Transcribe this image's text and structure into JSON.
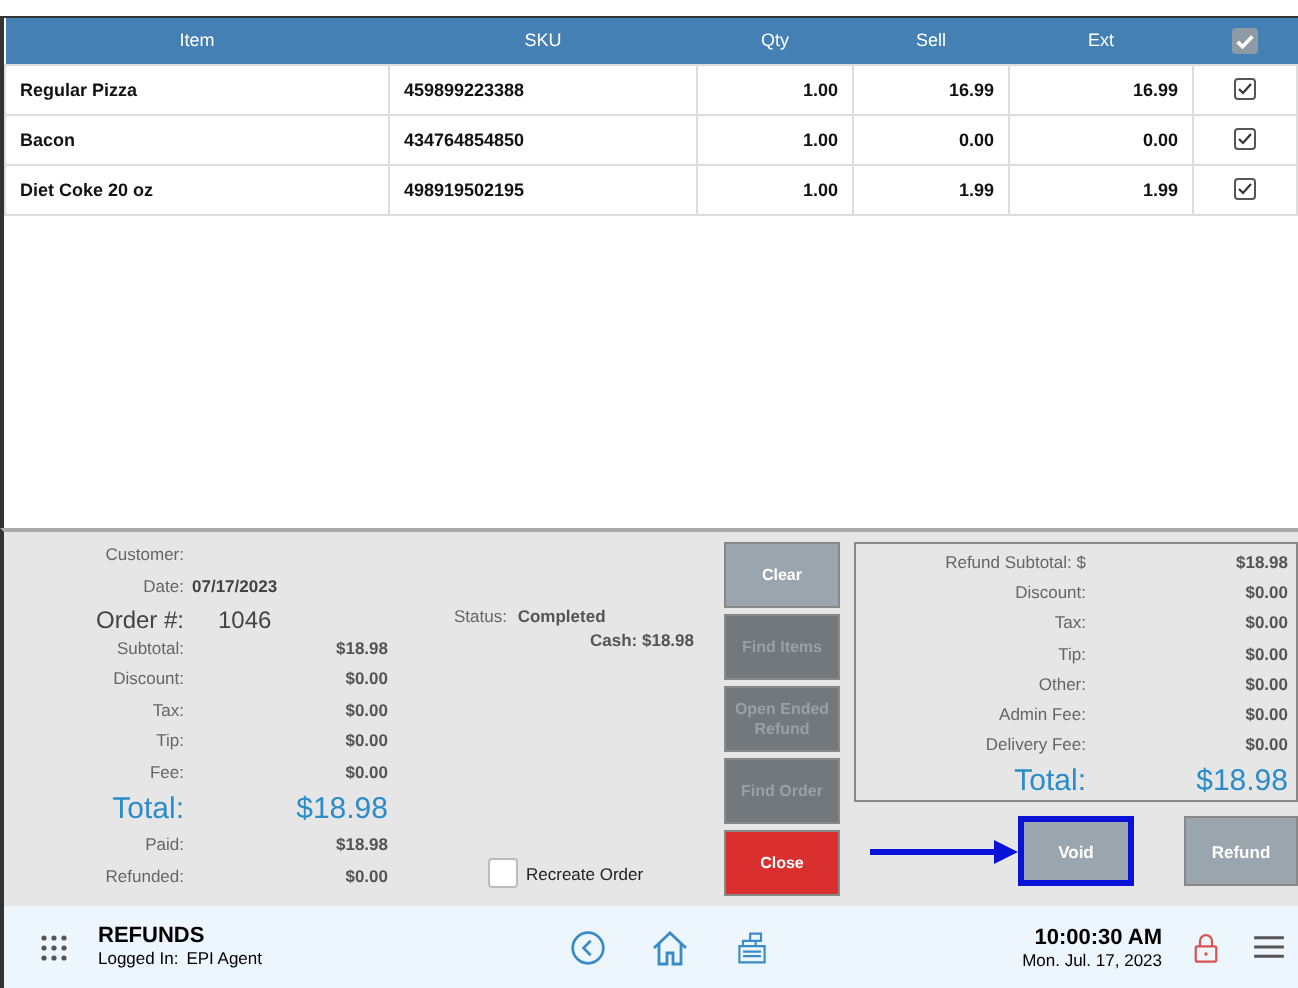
{
  "table": {
    "columns": [
      "Item",
      "SKU",
      "Qty",
      "Sell",
      "Ext"
    ],
    "all_checked": true,
    "rows": [
      {
        "item": "Regular Pizza",
        "sku": "459899223388",
        "qty": "1.00",
        "sell": "16.99",
        "ext": "16.99",
        "checked": true
      },
      {
        "item": "Bacon",
        "sku": "434764854850",
        "qty": "1.00",
        "sell": "0.00",
        "ext": "0.00",
        "checked": true
      },
      {
        "item": "Diet Coke 20 oz",
        "sku": "498919502195",
        "qty": "1.00",
        "sell": "1.99",
        "ext": "1.99",
        "checked": true
      }
    ]
  },
  "order_info": [
    {
      "kind": "plain",
      "label": "Customer:"
    },
    {
      "kind": "date",
      "label": "Date:",
      "value": "07/17/2023"
    },
    {
      "kind": "order",
      "label": "Order #:",
      "value": "1046"
    },
    {
      "kind": "amount",
      "label": "Subtotal:",
      "value": "$18.98"
    },
    {
      "kind": "amount",
      "label": "Discount:",
      "value": "$0.00"
    },
    {
      "kind": "amount",
      "label": "Tax:",
      "value": "$0.00"
    },
    {
      "kind": "amount",
      "label": "Tip:",
      "value": "$0.00"
    },
    {
      "kind": "amount",
      "label": "Fee:",
      "value": "$0.00"
    },
    {
      "kind": "total",
      "label": "Total:",
      "value": "$18.98"
    },
    {
      "kind": "amount",
      "label": "Paid:",
      "value": "$18.98"
    },
    {
      "kind": "amount",
      "label": "Refunded:",
      "value": "$0.00"
    }
  ],
  "status": {
    "label": "Status:",
    "value": "Completed",
    "payment": "Cash: $18.98"
  },
  "recreate_order": {
    "label": "Recreate Order",
    "checked": false
  },
  "actions": [
    {
      "label": "Clear",
      "kind": "normal",
      "disabled": false
    },
    {
      "label": "Find Items",
      "kind": "normal",
      "disabled": true
    },
    {
      "label": "Open Ended Refund",
      "kind": "normal",
      "disabled": true
    },
    {
      "label": "Find Order",
      "kind": "normal",
      "disabled": true
    },
    {
      "label": "Close",
      "kind": "danger",
      "disabled": false
    }
  ],
  "refund_summary": [
    {
      "kind": "amount",
      "label": "Refund Subtotal: $",
      "value": "$18.98"
    },
    {
      "kind": "amount",
      "label": "Discount:",
      "value": "$0.00"
    },
    {
      "kind": "amount",
      "label": "Tax:",
      "value": "$0.00"
    },
    {
      "kind": "amount",
      "label": "Tip:",
      "value": "$0.00"
    },
    {
      "kind": "amount",
      "label": "Other:",
      "value": "$0.00"
    },
    {
      "kind": "amount",
      "label": "Admin Fee:",
      "value": "$0.00"
    },
    {
      "kind": "amount",
      "label": "Delivery Fee:",
      "value": "$0.00"
    },
    {
      "kind": "total",
      "label": "Total:",
      "value": "$18.98"
    }
  ],
  "void_button": {
    "label": "Void",
    "highlighted": true
  },
  "refund_button": {
    "label": "Refund"
  },
  "footer": {
    "title": "REFUNDS",
    "logged_in_label": "Logged In:",
    "user": "EPI Agent",
    "time": "10:00:30 AM",
    "date": "Mon. Jul. 17, 2023"
  }
}
